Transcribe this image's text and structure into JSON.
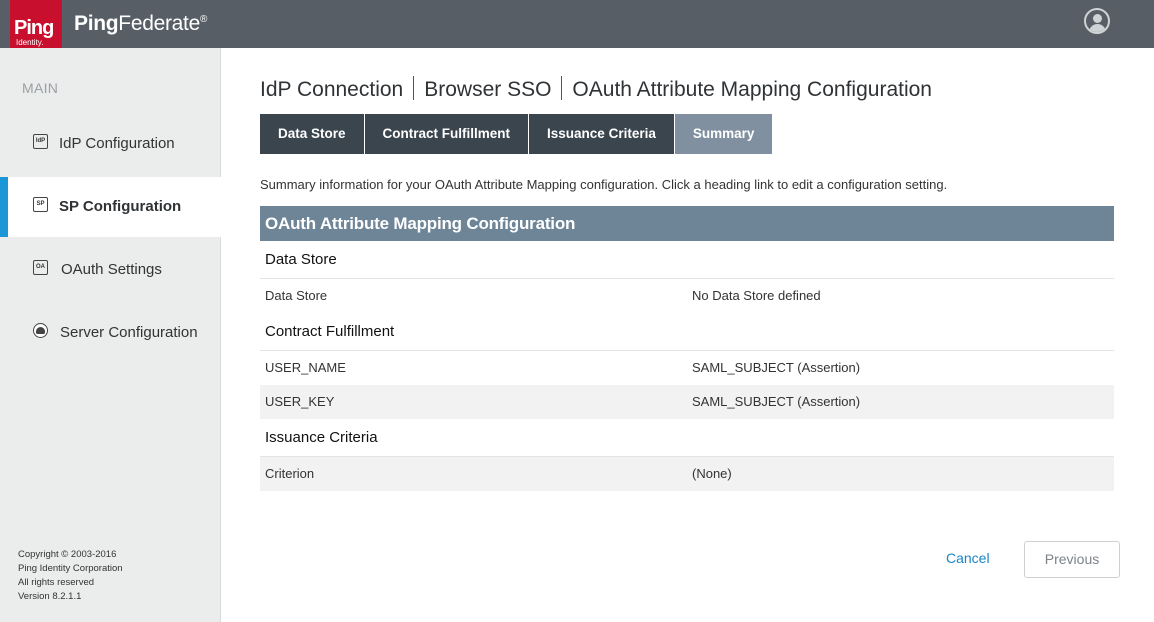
{
  "header": {
    "logo_text": "Ping",
    "logo_sub": "Identity.",
    "product_name_bold": "Ping",
    "product_name_rest": "Federate",
    "product_mark": "®",
    "user_icon": "user-avatar-icon"
  },
  "sidebar": {
    "section_label": "MAIN",
    "items": [
      {
        "label": "IdP Configuration",
        "icon_text": "IdP",
        "icon": "idp-icon"
      },
      {
        "label": "SP Configuration",
        "icon_text": "SP",
        "icon": "sp-icon",
        "active": true
      },
      {
        "label": "OAuth Settings",
        "icon_text": "OA",
        "icon": "oauth-icon"
      },
      {
        "label": "Server Configuration",
        "icon_text": "",
        "icon": "server-icon"
      }
    ],
    "copyright": [
      "Copyright © 2003-2016",
      "Ping Identity Corporation",
      "All rights reserved",
      "Version 8.2.1.1"
    ]
  },
  "breadcrumb": [
    "IdP Connection",
    "Browser SSO",
    "OAuth Attribute Mapping Configuration"
  ],
  "tabs": [
    {
      "label": "Data Store"
    },
    {
      "label": "Contract Fulfillment"
    },
    {
      "label": "Issuance Criteria"
    },
    {
      "label": "Summary",
      "active": true
    }
  ],
  "description": "Summary information for your OAuth Attribute Mapping configuration. Click a heading link to edit a configuration setting.",
  "summary": {
    "title": "OAuth Attribute Mapping Configuration",
    "sections": [
      {
        "title": "Data Store",
        "rows": [
          {
            "key": "Data Store",
            "value": "No Data Store defined"
          }
        ]
      },
      {
        "title": "Contract Fulfillment",
        "rows": [
          {
            "key": "USER_NAME",
            "value": "SAML_SUBJECT (Assertion)"
          },
          {
            "key": "USER_KEY",
            "value": "SAML_SUBJECT (Assertion)"
          }
        ]
      },
      {
        "title": "Issuance Criteria",
        "rows": [
          {
            "key": "Criterion",
            "value": "(None)"
          }
        ]
      }
    ]
  },
  "actions": {
    "cancel_label": "Cancel",
    "previous_label": "Previous"
  },
  "colors": {
    "header": "#575e65",
    "brand_red": "#c8102e",
    "accent_blue": "#1b96d6",
    "tab_dark": "#3b454e",
    "tab_active": "#8190a0",
    "panel_header": "#6e8497"
  }
}
